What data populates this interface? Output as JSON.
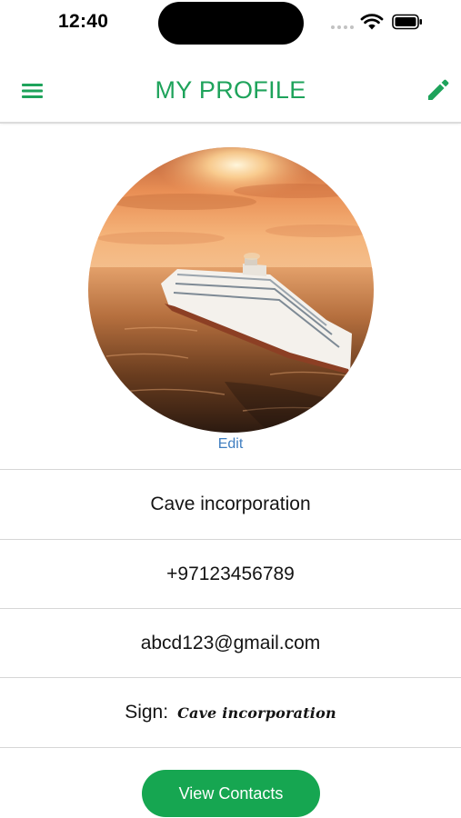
{
  "status_bar": {
    "time": "12:40"
  },
  "header": {
    "title": "MY PROFILE"
  },
  "profile": {
    "avatar_edit_label": "Edit",
    "company": "Cave incorporation",
    "phone": "+97123456789",
    "email": "abcd123@gmail.com",
    "sign_label": "Sign:",
    "sign_value": "Cave incorporation"
  },
  "actions": {
    "view_contacts_label": "View Contacts"
  },
  "colors": {
    "accent": "#1ea35b",
    "button": "#16a651",
    "link": "#3f7ec0"
  },
  "icons": [
    "menu-icon",
    "pencil-icon",
    "wifi-icon",
    "battery-icon",
    "signal-icon"
  ]
}
